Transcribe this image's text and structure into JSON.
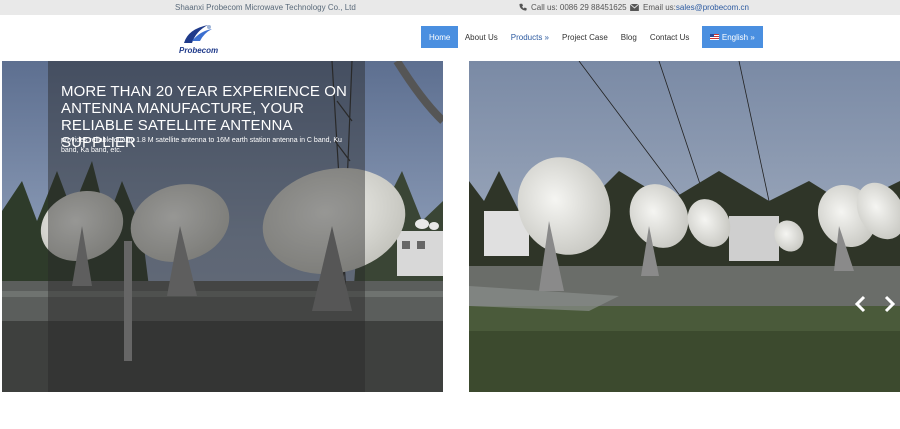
{
  "topbar": {
    "company": "Shaanxi Probecom Microwave Technology Co., Ltd",
    "call_label": "Call us: 0086 29 88451625",
    "email_prefix": "Email us:",
    "email": "sales@probecom.cn"
  },
  "logo": {
    "text": "Probecom"
  },
  "nav": {
    "home": "Home",
    "about": "About Us",
    "products": "Products »",
    "project": "Project Case",
    "blog": "Blog",
    "contact": "Contact Us",
    "language": "English »"
  },
  "slide": {
    "headline": "MORE THAN 20 YEAR EXPERIENCE ON ANTENNA MANUFACTURE, YOUR RELIABLE SATELLITE ANTENNA SUPPLIER",
    "subtext": "provides reliable quality 1.8 M satellite antenna to 16M earth station antenna in C band, Ku band, Ka band, etc."
  },
  "icons": {
    "phone": "phone-icon",
    "email": "envelope-icon",
    "prev": "chevron-left-icon",
    "next": "chevron-right-icon",
    "flag": "us-flag-icon"
  },
  "colors": {
    "accent": "#4a8fe0",
    "link": "#2c5aa0",
    "topbar_bg": "#e9e9e9"
  }
}
